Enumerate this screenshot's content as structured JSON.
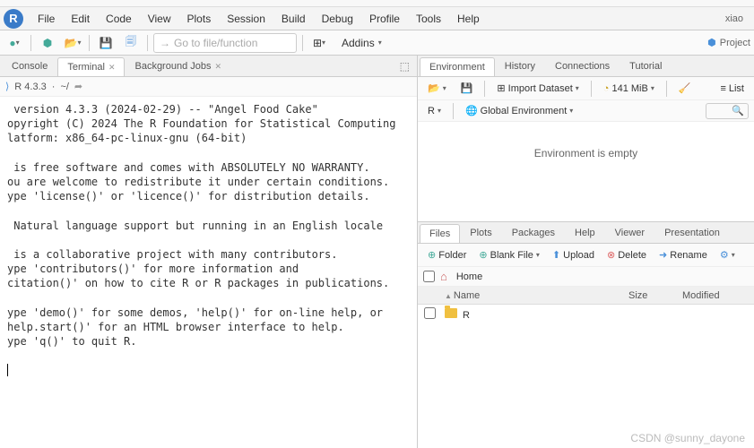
{
  "menubar": {
    "items": [
      "File",
      "Edit",
      "Code",
      "View",
      "Plots",
      "Session",
      "Build",
      "Debug",
      "Profile",
      "Tools",
      "Help"
    ],
    "user": "xiao"
  },
  "toolbar": {
    "goto_placeholder": "Go to file/function",
    "addins_label": "Addins",
    "project_label": "Project"
  },
  "left": {
    "tabs": [
      "Console",
      "Terminal",
      "Background Jobs"
    ],
    "active_tab": 1,
    "r_version": "R 4.3.3",
    "path": "~/",
    "console_text": " version 4.3.3 (2024-02-29) -- \"Angel Food Cake\"\nopyright (C) 2024 The R Foundation for Statistical Computing\nlatform: x86_64-pc-linux-gnu (64-bit)\n\n is free software and comes with ABSOLUTELY NO WARRANTY.\nou are welcome to redistribute it under certain conditions.\nype 'license()' or 'licence()' for distribution details.\n\n Natural language support but running in an English locale\n\n is a collaborative project with many contributors.\nype 'contributors()' for more information and\ncitation()' on how to cite R or R packages in publications.\n\nype 'demo()' for some demos, 'help()' for on-line help, or\nhelp.start()' for an HTML browser interface to help.\nype 'q()' to quit R.\n\n"
  },
  "right_top": {
    "tabs": [
      "Environment",
      "History",
      "Connections",
      "Tutorial"
    ],
    "active_tab": 0,
    "import_label": "Import Dataset",
    "mem_label": "141 MiB",
    "list_label": "List",
    "r_label": "R",
    "scope_label": "Global Environment",
    "empty_msg": "Environment is empty"
  },
  "right_bottom": {
    "tabs": [
      "Files",
      "Plots",
      "Packages",
      "Help",
      "Viewer",
      "Presentation"
    ],
    "active_tab": 0,
    "tools": {
      "folder": "Folder",
      "blank": "Blank File",
      "upload": "Upload",
      "delete": "Delete",
      "rename": "Rename"
    },
    "crumb": "Home",
    "headers": {
      "name": "Name",
      "size": "Size",
      "modified": "Modified"
    },
    "rows": [
      {
        "name": "R",
        "type": "folder"
      }
    ]
  },
  "watermark": "CSDN @sunny_dayone"
}
